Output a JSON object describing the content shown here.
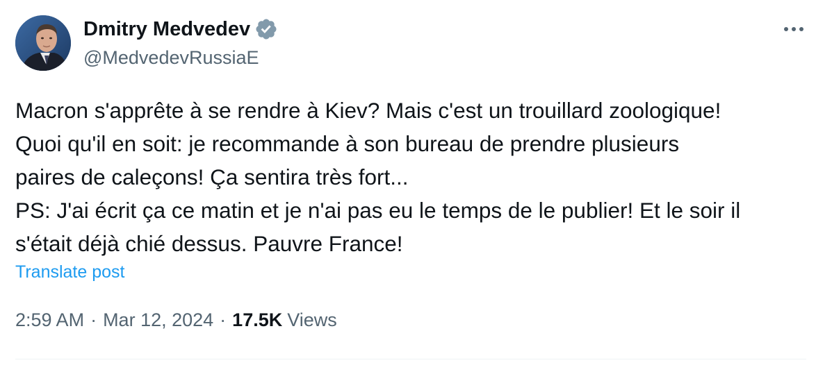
{
  "author": {
    "display_name": "Dmitry Medvedev",
    "handle": "@MedvedevRussiaE",
    "verified": true
  },
  "post": {
    "lines": [
      "Macron s'apprête à se rendre à Kiev? Mais c'est un trouillard zoologique!",
      "Quoi qu'il en soit: je recommande à son bureau de prendre plusieurs",
      "paires de caleçons! Ça sentira très fort...",
      "PS: J'ai écrit ça ce matin et je n'ai pas eu le temps de le publier! Et le soir il",
      "s'était déjà chié dessus. Pauvre France!"
    ],
    "translate_label": "Translate post"
  },
  "meta": {
    "time": "2:59 AM",
    "separator": "·",
    "date": "Mar 12, 2024",
    "views_count": "17.5K",
    "views_label": "Views"
  },
  "colors": {
    "text": "#0f1419",
    "secondary": "#536471",
    "link": "#1d9bf0",
    "verified_badge": "#829aab",
    "divider": "#eff3f4"
  },
  "icons": {
    "verified": "verified-badge-icon",
    "more": "more-icon"
  }
}
